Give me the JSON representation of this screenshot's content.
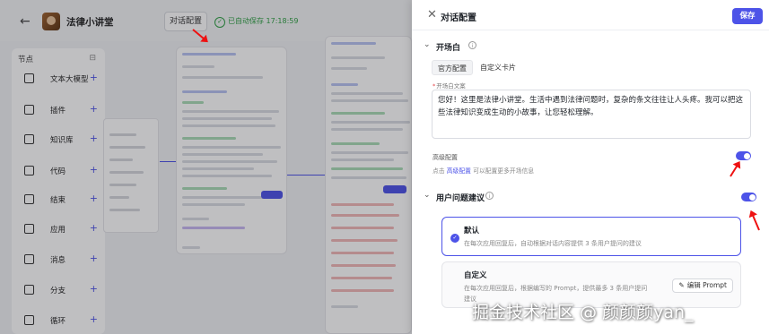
{
  "editor": {
    "app_title": "法律小讲堂",
    "dialog_config_button": "对话配置",
    "autosave_status": "已自动保存 17:18:59",
    "node_panel": {
      "title": "节点",
      "items": [
        {
          "label": "文本大模型"
        },
        {
          "label": "插件"
        },
        {
          "label": "知识库"
        },
        {
          "label": "代码"
        },
        {
          "label": "结束"
        },
        {
          "label": "应用"
        },
        {
          "label": "消息"
        },
        {
          "label": "分支"
        },
        {
          "label": "循环"
        }
      ]
    }
  },
  "panel": {
    "title": "对话配置",
    "save_label": "保存",
    "opening": {
      "title": "开场白",
      "tabs": [
        "官方配置",
        "自定义卡片"
      ],
      "textarea_label": "开场白文案",
      "textarea_value": "您好！这里是法律小讲堂。生活中遇到法律问题时，复杂的条文往往让人头疼。我可以把这些法律知识变成生动的小故事，让您轻松理解。",
      "advanced_label": "高级配置",
      "advanced_hint_prefix": "点击",
      "advanced_hint_link": "高级配置",
      "advanced_hint_suffix": "可以配置更多开场信息",
      "advanced_enabled": true
    },
    "suggestions": {
      "title": "用户问题建议",
      "enabled": true,
      "options": [
        {
          "title": "默认",
          "desc": "在每次应用回复后，自动根据对话内容提供 3 条用户提问的建议",
          "selected": true
        },
        {
          "title": "自定义",
          "desc": "在每次应用回复后，根据编写的 Prompt，提供最多 3 条用户提问",
          "desc2": "建议",
          "edit_label": "编辑 Prompt",
          "selected": false
        }
      ]
    }
  },
  "watermark": "掘金技术社区 @ 颜颜颜yan_",
  "colors": {
    "accent": "#4d53e8",
    "annotation": "#ee1111"
  }
}
